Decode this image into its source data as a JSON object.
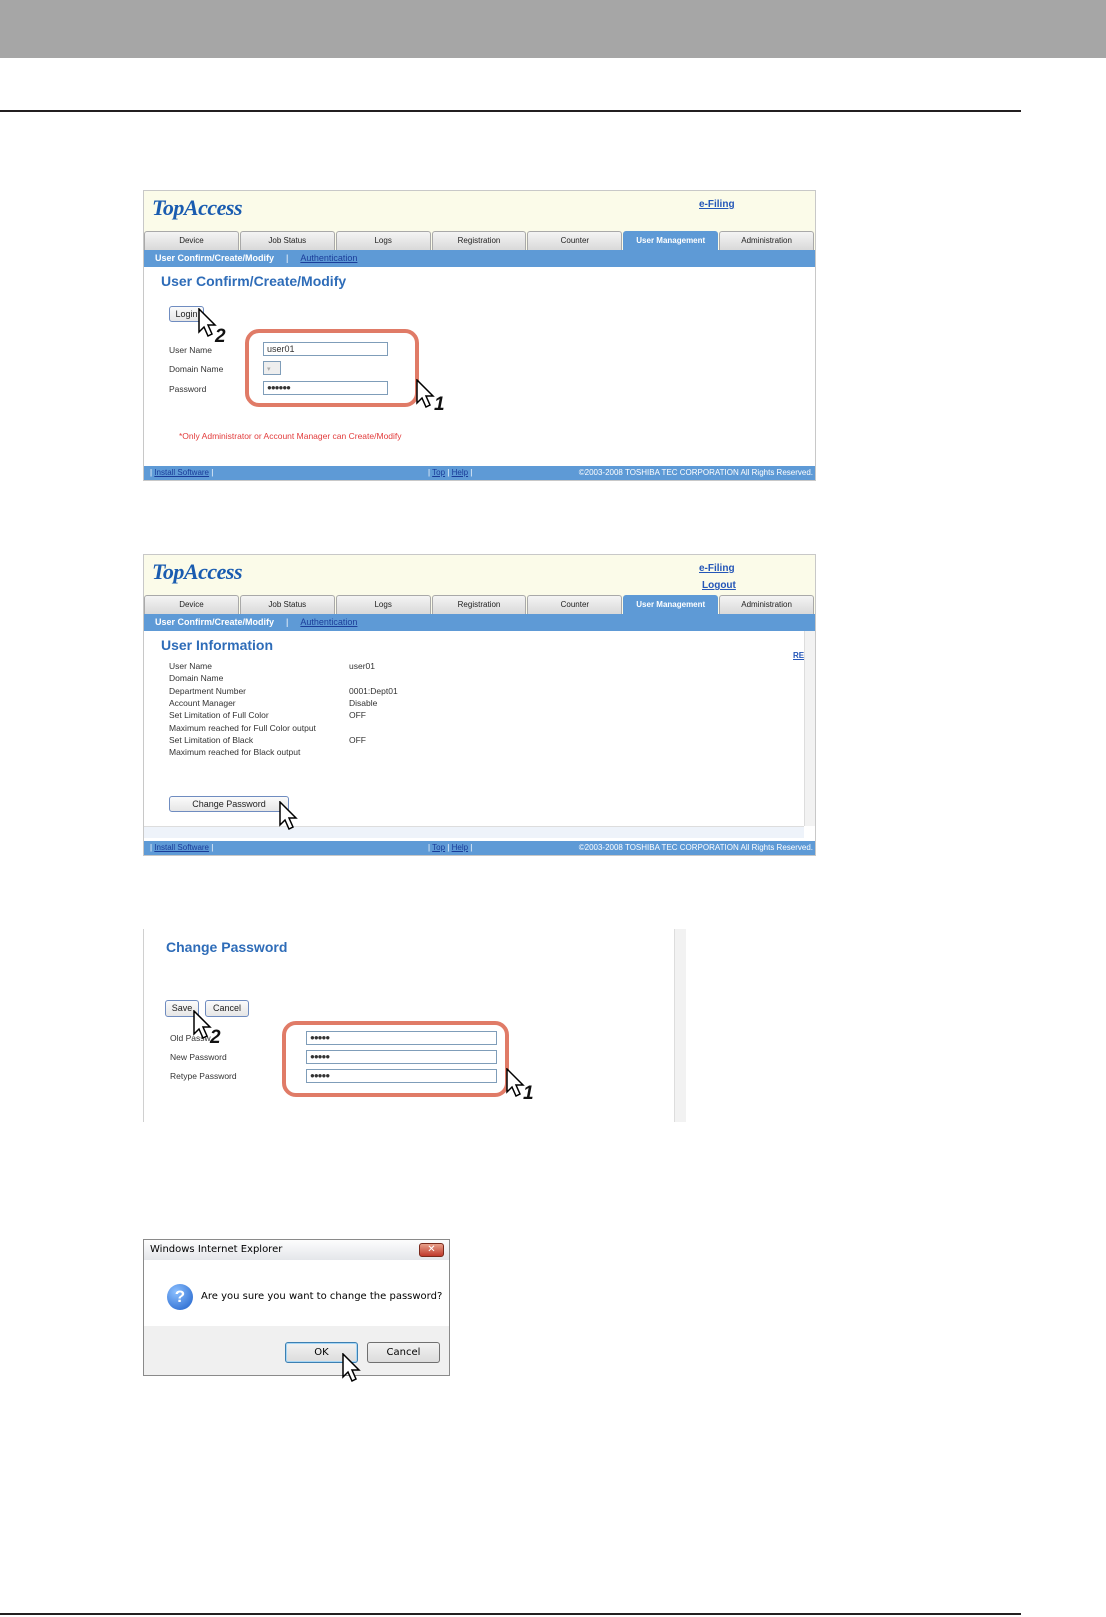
{
  "shot1": {
    "logo": "TopAccess",
    "efiling": "e-Filing",
    "tabs": [
      "Device",
      "Job Status",
      "Logs",
      "Registration",
      "Counter",
      "User Management",
      "Administration"
    ],
    "active_tab": "User Management",
    "subnav_active": "User Confirm/Create/Modify",
    "subnav_sep": "|",
    "subnav_link": "Authentication",
    "title": "User Confirm/Create/Modify",
    "login_button": "Login",
    "user_name_label": "User Name",
    "user_name_value": "user01",
    "domain_name_label": "Domain Name",
    "password_label": "Password",
    "password_value": "●●●●●●",
    "note": "*Only Administrator or Account Manager can Create/Modify",
    "footer_install": "Install Software",
    "footer_top": "Top",
    "footer_help": "Help",
    "footer_copyright": "©2003-2008 TOSHIBA TEC CORPORATION All Rights Reserved.",
    "step1": "1",
    "step2": "2"
  },
  "shot2": {
    "logo": "TopAccess",
    "efiling": "e-Filing",
    "logout": "Logout",
    "tabs": [
      "Device",
      "Job Status",
      "Logs",
      "Registration",
      "Counter",
      "User Management",
      "Administration"
    ],
    "subnav_active": "User Confirm/Create/Modify",
    "subnav_sep": "|",
    "subnav_link": "Authentication",
    "title": "User Information",
    "refresh_label": "RE",
    "rows": [
      {
        "label": "User Name",
        "value": "user01"
      },
      {
        "label": "Domain Name",
        "value": ""
      },
      {
        "label": "Department Number",
        "value": "0001:Dept01"
      },
      {
        "label": "Account Manager",
        "value": "Disable"
      },
      {
        "label": "Set Limitation of Full Color",
        "value": "OFF"
      },
      {
        "label": "Maximum reached for Full Color output",
        "value": ""
      },
      {
        "label": "Set Limitation of Black",
        "value": "OFF"
      },
      {
        "label": "Maximum reached for Black output",
        "value": ""
      }
    ],
    "change_password_button": "Change Password",
    "footer_install": "Install Software",
    "footer_top": "Top",
    "footer_help": "Help",
    "footer_copyright": "©2003-2008 TOSHIBA TEC CORPORATION All Rights Reserved."
  },
  "shot3": {
    "title": "Change Password",
    "save_button": "Save",
    "cancel_button": "Cancel",
    "old_password_label": "Old Passw",
    "new_password_label": "New Password",
    "retype_password_label": "Retype Password",
    "old_password_value": "●●●●●",
    "new_password_value": "●●●●●",
    "retype_password_value": "●●●●●",
    "step1": "1",
    "step2": "2"
  },
  "dialog": {
    "title": "Windows Internet Explorer",
    "close": "✕",
    "message": "Are you sure you want to change the password?",
    "icon": "?",
    "ok": "OK",
    "cancel": "Cancel"
  }
}
